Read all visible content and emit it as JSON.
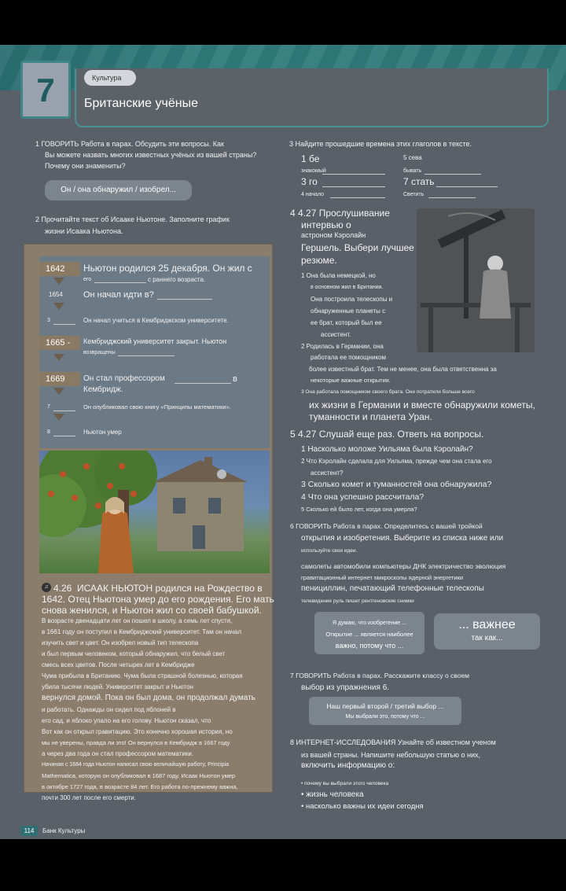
{
  "header": {
    "unit_number": "7",
    "tag": "Культура",
    "title": "Британские учёные"
  },
  "ex1": {
    "heading": "1 ГОВОРИТЬ Работа в парах. Обсудить эти вопросы. Как",
    "line2": "Вы можете назвать многих известных учёных из вашей страны?",
    "line3": "Почему они знамениты?",
    "pill": "Он / она обнаружил / изобрел..."
  },
  "ex2": {
    "heading": "2 Прочитайте текст об Исааке Ньютоне. Заполните график",
    "line2": "жизни Исаака Ньютона."
  },
  "timeline": [
    {
      "year": "1642",
      "text": "Ньютон родился 25 декабря. Он жил с",
      "sub": "его",
      "sub2": "с раннего возраста."
    },
    {
      "year": "1654",
      "text": "Он начал идти в?",
      "ref": "2"
    },
    {
      "year": "3",
      "text": "Он начал учиться в Кембриджском университете."
    },
    {
      "year": "1665 -",
      "text": "Кембриджский университет закрыт. Ньютон",
      "sub": "возвращены",
      "ref": "5"
    },
    {
      "year": "1669",
      "text": "Он стал профессором",
      "text2": "Кембридж.",
      "tail": "в",
      "ref": "6"
    },
    {
      "year": "7",
      "text": "Он опубликовал свою книгу «Принципы математики»."
    },
    {
      "year": "8",
      "text": "Ньютон умер"
    }
  ],
  "reading": {
    "audio": "4.26",
    "lines": [
      "ИСААК НЬЮТОН родился на Рождество в",
      "1642. Отец Ньютона умер до его рождения. Его мать",
      "снова женился, и Ньютон жил со своей бабушкой.",
      "В возрасте двенадцати лет он пошел в школу, а семь лет спустя,",
      "в 1661 году он поступил в Кембриджский университет. Там он начал",
      "изучить свет и цвет. Он изобрел новый тип телескопа",
      "и был первым человеком, который обнаружил, что белый свет",
      "смесь всех цветов. После четырех лет в Кембридже",
      "Чума прибыла в Британию. Чума была страшной болезнью, которая",
      "убила тысячи людей. Университет закрыт и Ньютон",
      "вернулся домой. Пока он был дома, он продолжал думать",
      "и работать. Однажды он сидел под яблоней в",
      "его сад, и яблоко упало на его голову. Ньютон сказал, что",
      "Вот как он открыл гравитацию. Это конечно хорошая история, но",
      "мы не уверены, правда ли это! Он вернулся в Кембридж в 1667 году",
      "а через два года он стал профессором математики.",
      "Начиная с 1684 года Ньютон написал свою величайшую работу, Principia",
      "Mathematica, которую он опубликовал в 1687 году. Исаак Ньютон умер",
      "в октябре 1727 года, в возрасте 84 лет. Его работа по-прежнему важна,",
      "почти 300 лет после его смерти."
    ]
  },
  "ex3": {
    "heading": "3 Найдите прошедшие времена этих глаголов в тексте.",
    "items": [
      {
        "num": "1 бе",
        "label": "знакомый"
      },
      {
        "num": "5 сева",
        "label": "бывать"
      },
      {
        "num": "3 го",
        "label": "идти"
      },
      {
        "num": "7 стать",
        "label": "бывать"
      },
      {
        "num": "4 начало",
        "label": ""
      },
      {
        "num": "Светить",
        "label": ""
      }
    ]
  },
  "ex4": {
    "heading": "4 4.27 Прослушивание",
    "lines": [
      "интервью о",
      "астроном Кэролайн",
      "Гершель. Выбери лучшее",
      "резюме."
    ],
    "opt1": [
      "1 Она была немецкой, но",
      "в основном жил в Британии.",
      "Она построила телескопы и",
      "обнаруженные планеты с",
      "ее брат, который был ее",
      "ассистент."
    ],
    "opt2": [
      "2 Родилась в Германии, она",
      "работала ее помощником",
      "более известный брат. Тем не менее, она была ответственна за",
      "некоторые важные открытия."
    ],
    "opt3": [
      "3 Она работала помощником своего брата. Они потратили больше всего",
      "их жизни в Германии и вместе обнаружили кометы,",
      "туманности и планета Уран."
    ]
  },
  "ex5": {
    "heading": "5 4.27 Слушай еще раз. Ответь на вопросы.",
    "q": [
      "1 Насколько моложе Уильяма была Кэролайн?",
      "2 Что Кэролайн сделала для Уильяма, прежде чем она стала его",
      "ассистент?",
      "3 Сколько комет и туманностей она обнаружила?",
      "4 Что она успешно рассчитала?",
      "5 Сколько ей было лет, когда она умерла?"
    ]
  },
  "ex6": {
    "heading": "6 ГОВОРИТЬ Работа в парах. Определитесь с вашей тройкой",
    "line2": "открытия и изобретения. Выберите из списка ниже или",
    "line3": "используйте свои идеи.",
    "list": [
      "самолеты автомобили компьютеры ДНК электричество эволюция",
      "гравитационный интернет микроскопы ядерной энергетики",
      "пенициллин, печатающий телефонные телескопы",
      "телевидение руль пишет рентгеновские снимки"
    ],
    "bubble": [
      "Я думаю, что изобретение ...",
      "Открытие ... является наиболее",
      "важно, потому что ..."
    ],
    "important": "... важнее",
    "important2": "так как..."
  },
  "ex7": {
    "heading": "7 ГОВОРИТЬ Работа в парах. Расскажите классу о своем",
    "line2": "выбор из упражнения 6.",
    "bubble1": "Наш первый второй / третий выбор ...",
    "bubble2": "Мы выбрали это, потому что ..."
  },
  "ex8": {
    "heading": "8 ИНТЕРНЕТ-ИССЛЕДОВАНИЯ Узнайте об известном ученом",
    "line2": "из вашей страны. Напишите небольшую статью о них,",
    "line3": "включить информацию о:",
    "bullets": [
      "• почему вы выбрали этого человека",
      "• жизнь человека",
      "• насколько важны их идеи сегодня"
    ]
  },
  "footer": {
    "page": "114",
    "label": "Банк Культуры"
  }
}
